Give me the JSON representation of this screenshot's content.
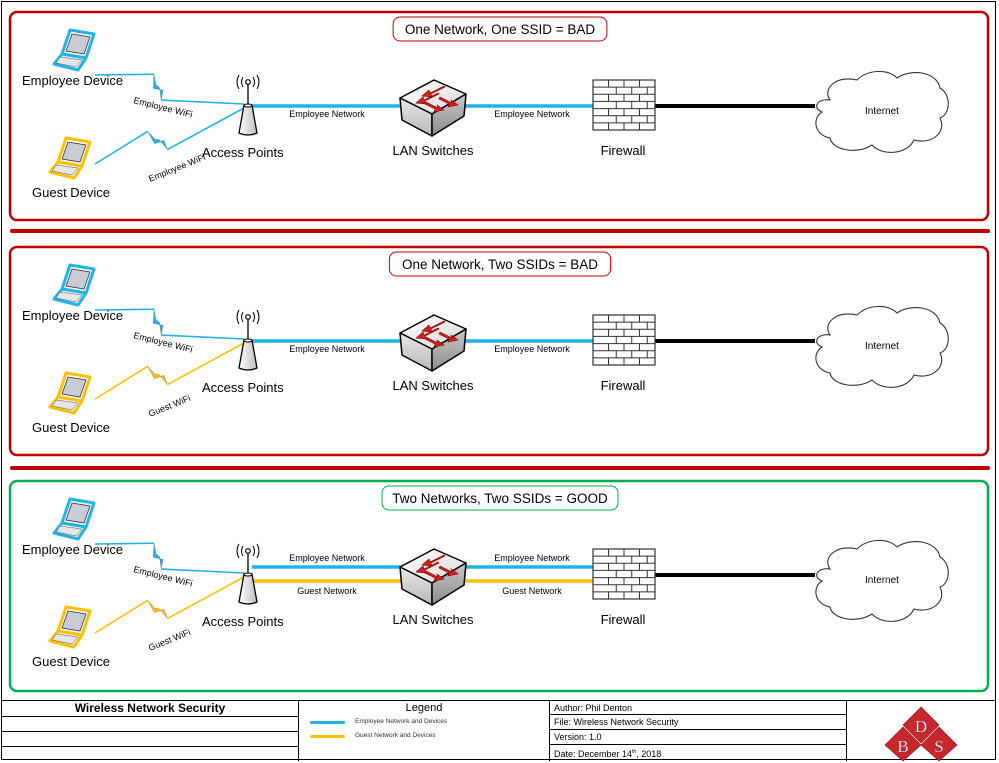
{
  "colors": {
    "bad": "#c00000",
    "good": "#00b050",
    "employee": "#1fb3e8",
    "guest": "#ffc000",
    "internet_link": "#000000",
    "logo_red": "#c8262d"
  },
  "panels": [
    {
      "title": "One Network, One SSID = BAD",
      "status": "bad",
      "employee_device": "Employee Device",
      "guest_device": "Guest Device",
      "employee_wifi_label": "Employee WiFi",
      "guest_wifi_label": "Employee WiFi",
      "guest_wifi_type": "employee",
      "access_points": "Access Points",
      "switch_label": "LAN Switches",
      "firewall_label": "Firewall",
      "internet_label": "Internet",
      "links": [
        {
          "segment": "ap-switch",
          "type": "employee",
          "label": "Employee Network"
        },
        {
          "segment": "switch-firewall",
          "type": "employee",
          "label": "Employee Network"
        }
      ]
    },
    {
      "title": "One Network, Two SSIDs = BAD",
      "status": "bad",
      "employee_device": "Employee Device",
      "guest_device": "Guest Device",
      "employee_wifi_label": "Employee WiFi",
      "guest_wifi_label": "Guest WiFi",
      "guest_wifi_type": "guest",
      "access_points": "Access Points",
      "switch_label": "LAN Switches",
      "firewall_label": "Firewall",
      "internet_label": "Internet",
      "links": [
        {
          "segment": "ap-switch",
          "type": "employee",
          "label": "Employee Network"
        },
        {
          "segment": "switch-firewall",
          "type": "employee",
          "label": "Employee Network"
        }
      ]
    },
    {
      "title": "Two Networks, Two SSIDs = GOOD",
      "status": "good",
      "employee_device": "Employee Device",
      "guest_device": "Guest Device",
      "employee_wifi_label": "Employee WiFi",
      "guest_wifi_label": "Guest WiFi",
      "guest_wifi_type": "guest",
      "access_points": "Access Points",
      "switch_label": "LAN Switches",
      "firewall_label": "Firewall",
      "internet_label": "Internet",
      "links": [
        {
          "segment": "ap-switch",
          "type": "employee",
          "label": "Employee Network"
        },
        {
          "segment": "switch-firewall",
          "type": "employee",
          "label": "Employee Network"
        },
        {
          "segment": "ap-switch",
          "type": "guest",
          "label": "Guest Network"
        },
        {
          "segment": "switch-firewall",
          "type": "guest",
          "label": "Guest Network"
        }
      ]
    }
  ],
  "title_block": {
    "title": "Wireless Network Security",
    "legend_title": "Legend",
    "legend": [
      {
        "type": "employee",
        "label": "Employee Network and Devices"
      },
      {
        "type": "guest",
        "label": "Guest Network and Devices"
      }
    ],
    "author": "Author:  Phil Denton",
    "file": "File:  Wireless Network Security",
    "version": "Version:  1.0",
    "date_prefix": "Date:  December 14",
    "date_sup": "th",
    "date_suffix": ", 2018",
    "logo_letters": [
      "B",
      "D",
      "S"
    ]
  }
}
